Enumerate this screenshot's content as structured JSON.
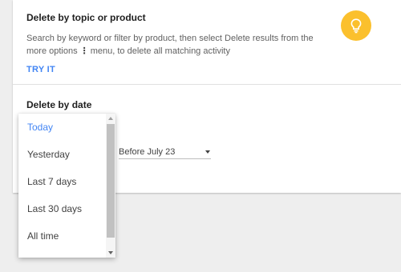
{
  "topic_section": {
    "title": "Delete by topic or product",
    "description_before": "Search by keyword or filter by product, then select Delete results from the more options",
    "description_after": "menu, to delete all matching activity",
    "kebab_glyph": "⋮",
    "try_it_label": "TRY IT",
    "icon": "lightbulb-icon",
    "icon_color": "#fbc02d"
  },
  "date_section": {
    "title": "Delete by date",
    "select_value": "Before July 23"
  },
  "dropdown": {
    "selected_index": 0,
    "options": [
      {
        "label": "Today"
      },
      {
        "label": "Yesterday"
      },
      {
        "label": "Last 7 days"
      },
      {
        "label": "Last 30 days"
      },
      {
        "label": "All time"
      }
    ]
  },
  "colors": {
    "accent": "#4285f4",
    "background": "#eeeeee",
    "card": "#ffffff"
  }
}
